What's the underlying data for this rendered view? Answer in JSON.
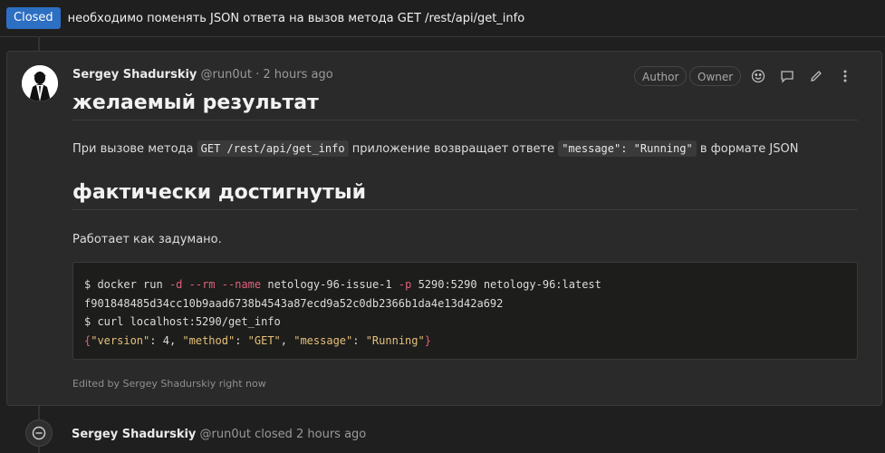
{
  "issue": {
    "status_label": "Closed",
    "title": "необходимо поменять JSON ответа на вызов метода GET /rest/api/get_info"
  },
  "comment": {
    "author": "Sergey Shadurskiy",
    "username": "@run0ut",
    "separator": "·",
    "time": "2 hours ago",
    "chips": [
      "Author",
      "Owner"
    ],
    "actions": [
      "emoji-icon",
      "reply-icon",
      "edit-icon",
      "more-icon"
    ],
    "heading_expected": "желаемый результат",
    "para1_prefix": "При вызове метода",
    "para1_code1": "GET /rest/api/get_info",
    "para1_mid": "приложение возвращает ответе",
    "para1_code2": "\"message\": \"Running\"",
    "para1_suffix": "в формате JSON",
    "heading_actual": "фактически достигнутый",
    "para2": "Работает как задумано.",
    "code": {
      "l1_prompt": "$ docker run",
      "l1_flag_d": "-d",
      "l1_flag_rm": "--rm",
      "l1_flag_name": "--name",
      "l1_name_val": "netology-96-issue-1",
      "l1_flag_p": "-p",
      "l1_port": "5290:5290",
      "l1_image": "netology-96:latest",
      "l2": "f901848485d34cc10b9aad6738b4543a87ecd9a52c0db2366b1da4e13d42a692",
      "l3": "$ curl localhost:5290/get_info",
      "l4_open": "{",
      "l4_k1": "\"version\"",
      "l4_v1": ": 4, ",
      "l4_k2": "\"method\"",
      "l4_colon2": ": ",
      "l4_v2": "\"GET\"",
      "l4_comma2": ", ",
      "l4_k3": "\"message\"",
      "l4_colon3": ": ",
      "l4_v3": "\"Running\"",
      "l4_close": "}"
    },
    "edited_note": "Edited by Sergey Shadurskiy right now"
  },
  "event": {
    "author": "Sergey Shadurskiy",
    "username": "@run0ut",
    "action": "closed",
    "time": "2 hours ago"
  },
  "colors": {
    "closed_badge": "#2d6fc2",
    "code_flag": "#e0607a",
    "code_string": "#e5c07b"
  }
}
